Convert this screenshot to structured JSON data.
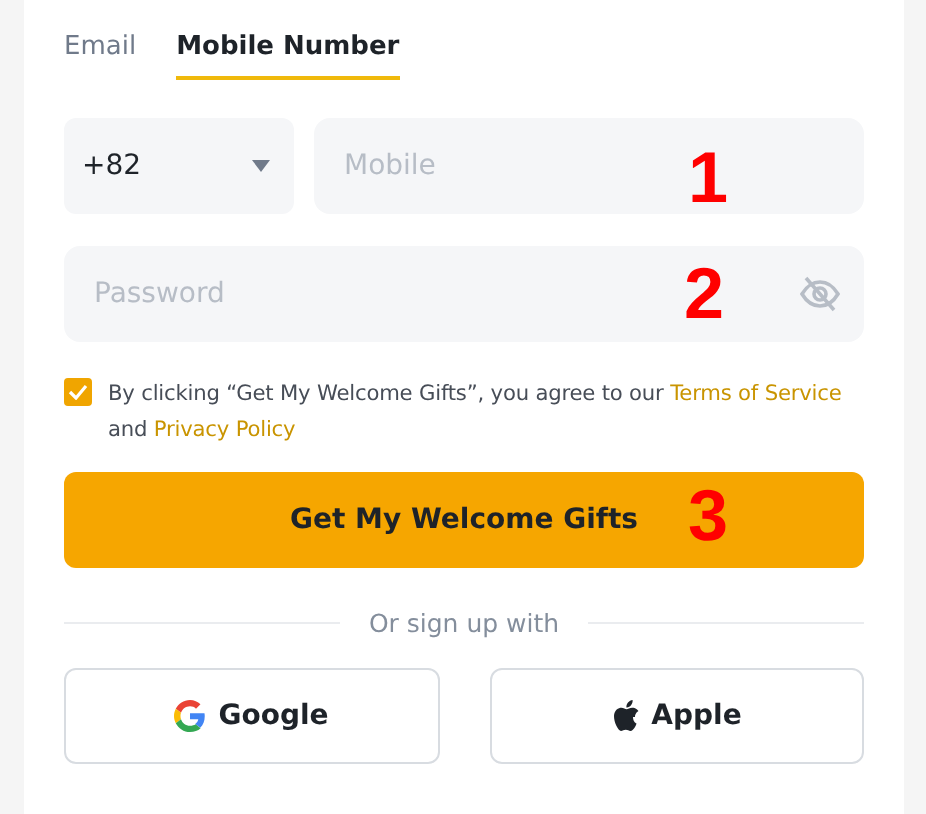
{
  "tabs": [
    {
      "label": "Email",
      "selected": false
    },
    {
      "label": "Mobile Number",
      "selected": true
    }
  ],
  "country_code": {
    "value": "+82"
  },
  "mobile": {
    "placeholder": "Mobile"
  },
  "password": {
    "placeholder": "Password"
  },
  "agreement": {
    "checked": true,
    "text_before": "By clicking “Get My Welcome Gifts”, you agree to our",
    "terms_link": "Terms of Service",
    "text_middle": "and",
    "privacy_link": "Privacy Policy"
  },
  "submit_button": "Get My Welcome Gifts",
  "divider_text": "Or sign up with",
  "social_buttons": [
    {
      "kind": "google",
      "label": "Google"
    },
    {
      "kind": "apple",
      "label": "Apple"
    }
  ],
  "annotations": [
    "1",
    "2",
    "3"
  ]
}
